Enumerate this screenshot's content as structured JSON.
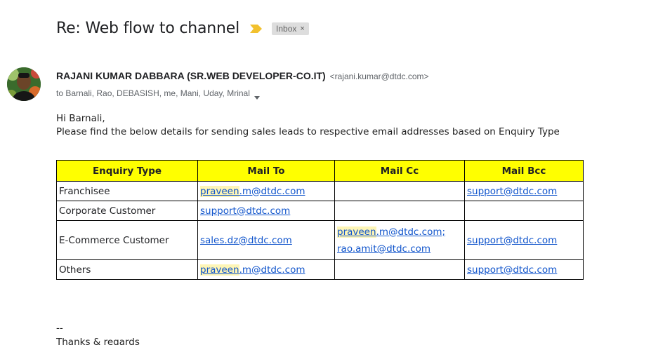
{
  "email": {
    "subject": "Re: Web flow to channel",
    "label": "Inbox",
    "label_close": "×",
    "sender_name": "RAJANI KUMAR DABBARA (SR.WEB DEVELOPER-CO.IT)",
    "sender_email": "<rajani.kumar@dtdc.com>",
    "recipients": "to Barnali, Rao, DEBASISH, me, Mani, Uday, Mrinal"
  },
  "body": {
    "greeting": "Hi Barnali,",
    "intro": "Please find the below details for sending sales leads to respective email addresses based on Enquiry Type"
  },
  "table": {
    "headers": [
      "Enquiry Type",
      "Mail To",
      "Mail Cc",
      "Mail Bcc"
    ],
    "rows": [
      {
        "type": "Franchisee",
        "to_hl": "praveen",
        "to_rest": ".m@dtdc.com",
        "cc_1_hl": "",
        "cc_1_rest": "",
        "cc_2": "",
        "bcc": "support@dtdc.com"
      },
      {
        "type": "Corporate Customer",
        "to_hl": "",
        "to_rest": "support@dtdc.com",
        "cc_1_hl": "",
        "cc_1_rest": "",
        "cc_2": "",
        "bcc": ""
      },
      {
        "type": "E-Commerce Customer",
        "to_hl": "",
        "to_rest": "sales.dz@dtdc.com",
        "cc_1_hl": "praveen",
        "cc_1_rest": ".m@dtdc.com;",
        "cc_2": "rao.amit@dtdc.com",
        "bcc": "support@dtdc.com"
      },
      {
        "type": "Others",
        "to_hl": "praveen",
        "to_rest": ".m@dtdc.com",
        "cc_1_hl": "",
        "cc_1_rest": "",
        "cc_2": "",
        "bcc": "support@dtdc.com"
      }
    ]
  },
  "signature": {
    "dashes": "--",
    "closing": "Thanks & regards"
  },
  "colors": {
    "header_fill": "#ffff00",
    "link": "#1155cc",
    "highlight": "#fdf5b6",
    "importance": "#f2c12e"
  }
}
